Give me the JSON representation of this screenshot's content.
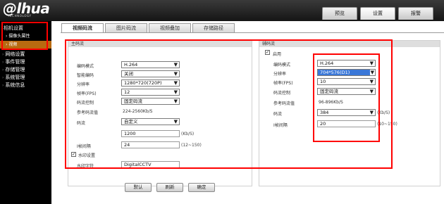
{
  "brand": {
    "logo": "@lhua",
    "tagline": "TECHNOLOGY"
  },
  "top_tabs": [
    {
      "label": "预览"
    },
    {
      "label": "设置"
    },
    {
      "label": "报警"
    }
  ],
  "sidebar": {
    "camera_settings": "相机设置",
    "camera_props": "摄像头属性",
    "video": "视频",
    "items": [
      {
        "label": "网络设置"
      },
      {
        "label": "事件管理"
      },
      {
        "label": "存储管理"
      },
      {
        "label": "系统管理"
      },
      {
        "label": "系统信息"
      }
    ]
  },
  "sub_tabs": [
    {
      "label": "视频码流"
    },
    {
      "label": "图片码流"
    },
    {
      "label": "视频叠加"
    },
    {
      "label": "存储路径"
    }
  ],
  "main_stream": {
    "title": "主码流",
    "codec_label": "编码模式",
    "codec_value": "H.264",
    "smart_label": "智能编码",
    "smart_value": "关闭",
    "resolution_label": "分辨率",
    "resolution_value": "1280*720(720P)",
    "fps_label": "帧率(FPS)",
    "fps_value": "12",
    "bitrate_ctrl_label": "码流控制",
    "bitrate_ctrl_value": "固定码流",
    "ref_bitrate_label": "参考码流值",
    "ref_bitrate_value": "224-2560Kb/S",
    "bitrate_label": "码流",
    "bitrate_value": "自定义",
    "custom_bitrate_value": "1200",
    "custom_bitrate_unit": "(Kb/S)",
    "iframe_label": "I帧间隔",
    "iframe_value": "24",
    "iframe_range": "(12~150)",
    "watermark_label": "水印设置",
    "watermark_checked": "✓",
    "watermark_text_label": "水印字符",
    "watermark_text_value": "DigitalCCTV"
  },
  "sub_stream": {
    "title": "辅码流",
    "enable_label": "启用",
    "enable_checked": "✓",
    "codec_label": "编码模式",
    "codec_value": "H.264",
    "resolution_label": "分辨率",
    "resolution_value": "704*576(D1)",
    "fps_label": "帧率(FPS)",
    "fps_value": "10",
    "bitrate_ctrl_label": "码流控制",
    "bitrate_ctrl_value": "固定码流",
    "ref_bitrate_label": "参考码流值",
    "ref_bitrate_value": "96-896Kb/S",
    "bitrate_label": "码流",
    "bitrate_value": "384",
    "bitrate_unit": "(Kb/S)",
    "iframe_label": "I帧间隔",
    "iframe_value": "20",
    "iframe_range": "(10~150)"
  },
  "buttons": {
    "default": "默认",
    "refresh": "刷新",
    "confirm": "确定"
  },
  "colors": {
    "highlight_box": "#ff0000",
    "sidebar_selected": "#b86a10",
    "dropdown_selected": "#3b78d8"
  }
}
